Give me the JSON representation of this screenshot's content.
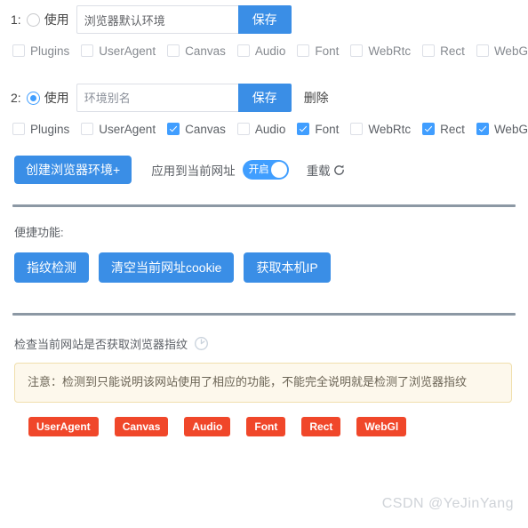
{
  "profiles": [
    {
      "index": "1:",
      "use_label": "使用",
      "selected": false,
      "alias_value": "浏览器默认环境",
      "alias_placeholder": "环境别名",
      "save_label": "保存",
      "delete_label": "",
      "has_delete": false,
      "options": [
        {
          "label": "Plugins",
          "checked": false
        },
        {
          "label": "UserAgent",
          "checked": false
        },
        {
          "label": "Canvas",
          "checked": false
        },
        {
          "label": "Audio",
          "checked": false
        },
        {
          "label": "Font",
          "checked": false
        },
        {
          "label": "WebRtc",
          "checked": false
        },
        {
          "label": "Rect",
          "checked": false
        },
        {
          "label": "WebGl",
          "checked": false
        }
      ]
    },
    {
      "index": "2:",
      "use_label": "使用",
      "selected": true,
      "alias_value": "环境别名",
      "alias_placeholder": "环境别名",
      "save_label": "保存",
      "delete_label": "删除",
      "has_delete": true,
      "options": [
        {
          "label": "Plugins",
          "checked": false
        },
        {
          "label": "UserAgent",
          "checked": false
        },
        {
          "label": "Canvas",
          "checked": true
        },
        {
          "label": "Audio",
          "checked": false
        },
        {
          "label": "Font",
          "checked": true
        },
        {
          "label": "WebRtc",
          "checked": false
        },
        {
          "label": "Rect",
          "checked": true
        },
        {
          "label": "WebGl",
          "checked": true
        }
      ]
    }
  ],
  "action_bar": {
    "create_label": "创建浏览器环境+",
    "apply_label": "应用到当前网址",
    "toggle_text": "开启",
    "toggle_on": true,
    "reload_label": "重载",
    "reload_icon": "refresh-icon"
  },
  "shortcuts": {
    "section_label": "便捷功能:",
    "buttons": [
      "指纹检测",
      "清空当前网址cookie",
      "获取本机IP"
    ]
  },
  "detect": {
    "title": "检查当前网站是否获取浏览器指纹",
    "spinner_icon": "refresh-circle-icon",
    "notice": "注意：检测到只能说明该网站使用了相应的功能，不能完全说明就是检测了浏览器指纹",
    "tags": [
      "UserAgent",
      "Canvas",
      "Audio",
      "Font",
      "Rect",
      "WebGl"
    ]
  },
  "watermark": "CSDN @YeJinYang",
  "colors": {
    "primary": "#409eff",
    "button": "#3a8ee6",
    "tag": "#f0472a",
    "notice_bg": "#fdf8ec",
    "notice_border": "#f0dfad",
    "divider": "#8c98a4"
  }
}
